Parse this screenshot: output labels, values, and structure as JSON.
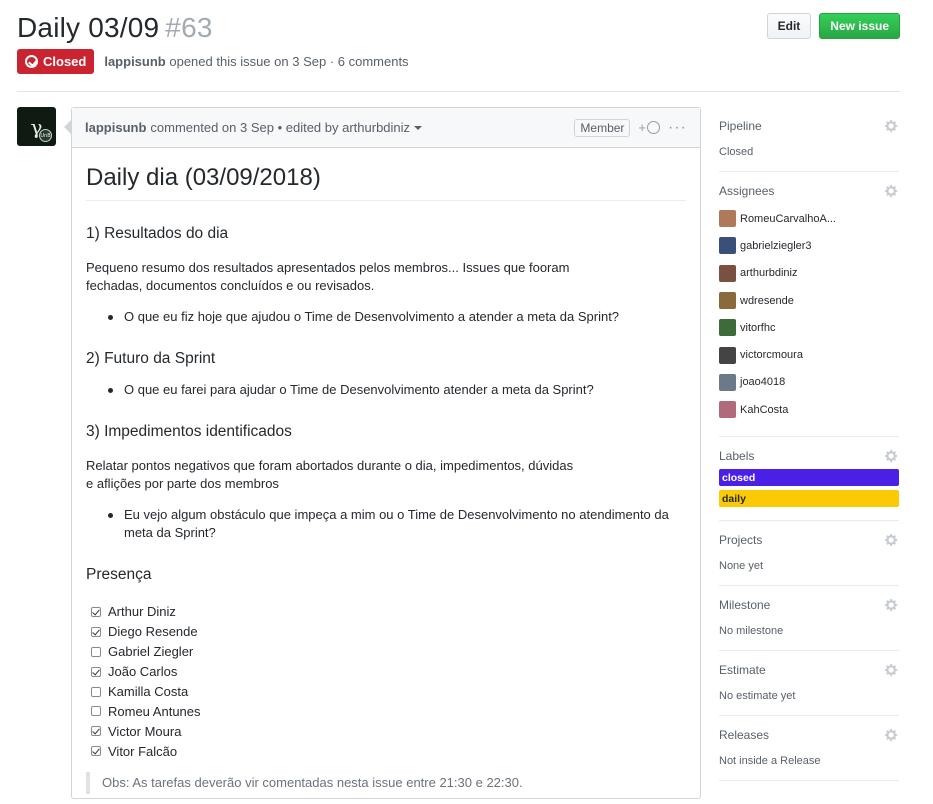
{
  "issue": {
    "title": "Daily 03/09",
    "number": "#63",
    "state": "Closed",
    "author": "lappisunb",
    "opened_text": "opened this issue on 3 Sep · 6 comments",
    "edit_label": "Edit",
    "new_issue_label": "New issue"
  },
  "comment": {
    "author": "lappisunb",
    "meta_text": "commented on 3 Sep • edited by arthurbdiniz",
    "role": "Member",
    "reaction_label": "+",
    "more_label": "···",
    "avatar_text": "γ",
    "avatar_badge": "UnB",
    "h1": "Daily dia (03/09/2018)",
    "sections": [
      {
        "heading": "1) Resultados do dia",
        "paragraph": "Pequeno resumo dos resultados apresentados pelos membros... Issues que fooram\nfechadas, documentos concluídos e ou revisados.",
        "bullet": "O que eu fiz hoje que ajudou o Time de Desenvolvimento a atender a meta da Sprint?"
      },
      {
        "heading": "2) Futuro da Sprint",
        "bullet": "O que eu farei para ajudar o Time de Desenvolvimento atender a meta da Sprint?"
      },
      {
        "heading": "3) Impedimentos identificados",
        "paragraph": "Relatar pontos negativos que foram abortados durante o dia, impedimentos, dúvidas\ne aflições por parte dos membros",
        "bullet": "Eu vejo algum obstáculo que impeça a mim ou o Time de Desenvolvimento no atendimento da meta da Sprint?"
      }
    ],
    "presence_heading": "Presença",
    "presence": [
      {
        "name": "Arthur Diniz",
        "checked": true
      },
      {
        "name": "Diego Resende",
        "checked": true
      },
      {
        "name": "Gabriel Ziegler",
        "checked": false
      },
      {
        "name": "João Carlos",
        "checked": true
      },
      {
        "name": "Kamilla Costa",
        "checked": false
      },
      {
        "name": "Romeu Antunes",
        "checked": false
      },
      {
        "name": "Victor Moura",
        "checked": true
      },
      {
        "name": "Vitor Falcão",
        "checked": true
      }
    ],
    "note": "Obs: As tarefas deverão vir comentadas nesta issue entre 21:30 e 22:30."
  },
  "sidebar": {
    "pipeline": {
      "label": "Pipeline",
      "value": "Closed"
    },
    "assignees": {
      "label": "Assignees",
      "people": [
        {
          "name": "RomeuCarvalhoA...",
          "color": "#b07a5a"
        },
        {
          "name": "gabrielziegler3",
          "color": "#3a4f7a"
        },
        {
          "name": "arthurbdiniz",
          "color": "#7a5040"
        },
        {
          "name": "wdresende",
          "color": "#8a6a3a"
        },
        {
          "name": "vitorfhc",
          "color": "#3d6b3a"
        },
        {
          "name": "victorcmoura",
          "color": "#444444"
        },
        {
          "name": "joao4018",
          "color": "#6a7a8a"
        },
        {
          "name": "KahCosta",
          "color": "#b06a7a"
        }
      ]
    },
    "labels": {
      "label": "Labels",
      "items": [
        {
          "name": "closed",
          "bg": "#4a1fe6",
          "fg": "#ffffff"
        },
        {
          "name": "daily",
          "bg": "#fbca04",
          "fg": "#24292e"
        }
      ]
    },
    "projects": {
      "label": "Projects",
      "value": "None yet"
    },
    "milestone": {
      "label": "Milestone",
      "value": "No milestone"
    },
    "estimate": {
      "label": "Estimate",
      "value": "No estimate yet"
    },
    "releases": {
      "label": "Releases",
      "value": "Not inside a Release"
    }
  }
}
